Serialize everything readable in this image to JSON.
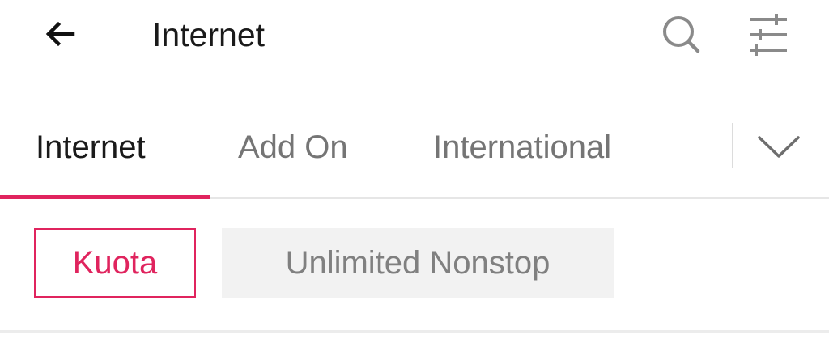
{
  "header": {
    "title": "Internet",
    "back_icon": "arrow-left-icon",
    "search_icon": "search-icon",
    "filter_icon": "sliders-icon"
  },
  "tabs": [
    {
      "label": "Internet",
      "active": true
    },
    {
      "label": "Add On",
      "active": false
    },
    {
      "label": "International",
      "active": false
    }
  ],
  "tab_dropdown_icon": "chevron-down-icon",
  "filters": [
    {
      "label": "Kuota",
      "selected": true
    },
    {
      "label": "Unlimited Nonstop",
      "selected": false
    }
  ],
  "colors": {
    "accent": "#e0245e",
    "text_primary": "#1a1a1a",
    "text_secondary": "#757575",
    "chip_background": "#f2f2f2"
  }
}
